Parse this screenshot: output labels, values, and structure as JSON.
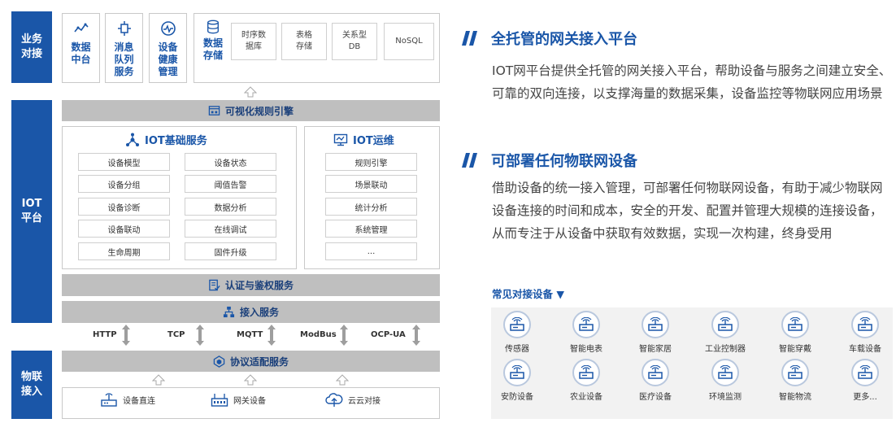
{
  "colors": {
    "brand": "#1a56a8",
    "bar_gray": "#bfbfbf",
    "border": "#c9c9c9",
    "device_bg": "#f2f2f2"
  },
  "categories": {
    "business": "业务\n对接",
    "iot_platform": "IOT\n平台",
    "physical": "物联\n接入"
  },
  "business": {
    "data_center": "数据\n中台",
    "message_queue": "消息\n队列\n服务",
    "device_health": "设备\n健康\n管理",
    "data_storage": "数据\n存储",
    "storage_types": [
      "时序数\n据库",
      "表格\n存储",
      "关系型\nDB",
      "NoSQL"
    ]
  },
  "bars": {
    "rule_engine": "可视化规则引擎",
    "auth": "认证与鉴权服务",
    "access_service": "接入服务",
    "protocol_adapter": "协议适配服务"
  },
  "iot_basic": {
    "title": "IOT基础服务",
    "col1": [
      "设备模型",
      "设备分组",
      "设备诊断",
      "设备联动",
      "生命周期"
    ],
    "col2": [
      "设备状态",
      "阈值告警",
      "数据分析",
      "在线调试",
      "固件升级"
    ]
  },
  "iot_ops": {
    "title": "IOT运维",
    "items": [
      "规则引擎",
      "场景联动",
      "统计分析",
      "系统管理",
      "..."
    ]
  },
  "protocols": [
    "HTTP",
    "TCP",
    "MQTT",
    "ModBus",
    "OCP-UA"
  ],
  "access_methods": [
    "设备直连",
    "网关设备",
    "云云对接"
  ],
  "right": {
    "title1": "全托管的网关接入平台",
    "para1": "IOT网平台提供全托管的网关接入平台，帮助设备与服务之间建立安全、可靠的双向连接，以支撑海量的数据采集，设备监控等物联网应用场景",
    "title2": "可部署任何物联网设备",
    "para2": "借助设备的统一接入管理，可部署任何物联网设备，有助于减少物联网设备连接的时间和成本，安全的开发、配置并管理大规模的连接设备，从而专注于从设备中获取有效数据，实现一次构建，终身受用",
    "common_devices": "常见对接设备 ▼",
    "devices_row1": [
      "传感器",
      "智能电表",
      "智能家居",
      "工业控制器",
      "智能穿戴",
      "车载设备"
    ],
    "devices_row2": [
      "安防设备",
      "农业设备",
      "医疗设备",
      "环境监测",
      "智能物流",
      "更多..."
    ]
  }
}
